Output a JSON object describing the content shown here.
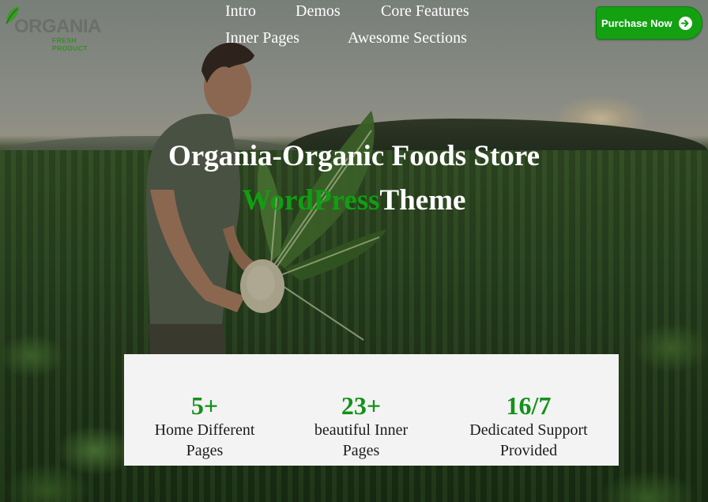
{
  "logo": {
    "name": "ORGANIA",
    "tagline": "FRESH PRODUCT"
  },
  "nav": {
    "items": [
      {
        "label": "Intro"
      },
      {
        "label": "Demos"
      },
      {
        "label": "Core Features"
      },
      {
        "label": "Inner Pages"
      },
      {
        "label": "Awesome Sections"
      }
    ]
  },
  "header": {
    "purchase_label": "Purchase Now",
    "purchase_icon": "arrow-right-circle-icon"
  },
  "hero": {
    "title_line1": "Organia-Organic Foods Store",
    "title_accent": "WordPress",
    "title_rest": "Theme",
    "accent_color": "#119e12"
  },
  "stats": [
    {
      "value": "5+",
      "label_line1": "Home Different",
      "label_line2": "Pages"
    },
    {
      "value": "23+",
      "label_line1": "beautiful Inner",
      "label_line2": "Pages"
    },
    {
      "value": "16/7",
      "label_line1": "Dedicated Support",
      "label_line2": "Provided"
    }
  ],
  "colors": {
    "brand_green": "#13a112",
    "stat_green": "#13911a"
  }
}
